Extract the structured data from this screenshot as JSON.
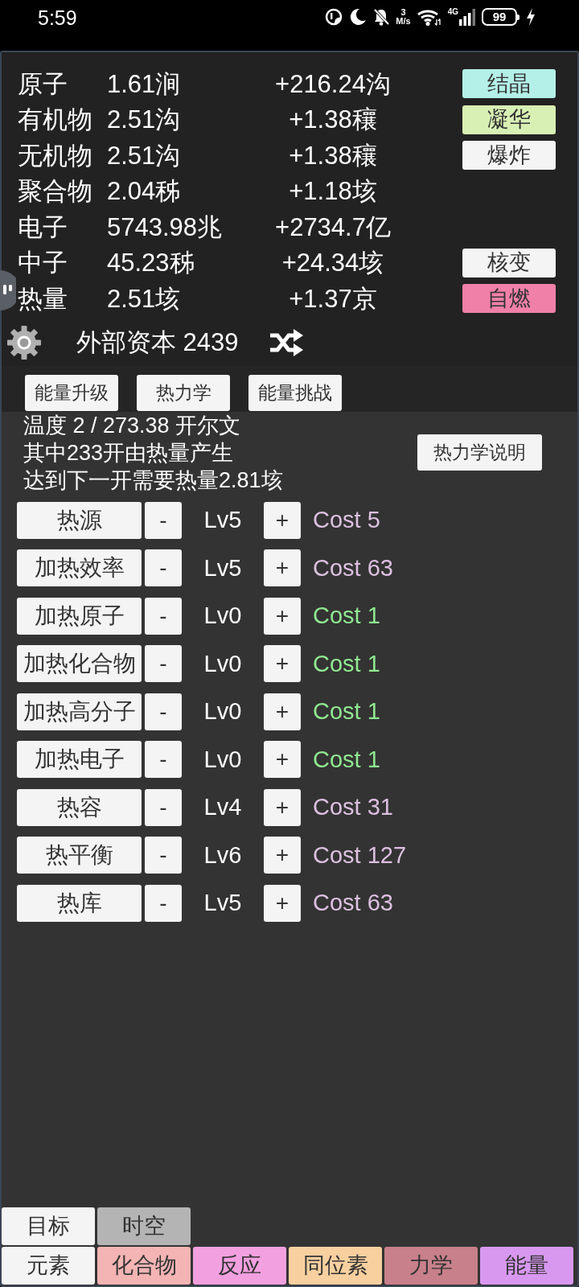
{
  "status_bar": {
    "time": "5:59",
    "net_speed": "3",
    "net_speed_unit": "M/s",
    "network": "4G",
    "battery": "99"
  },
  "resources": [
    {
      "name": "原子",
      "amount": "1.61涧",
      "rate": "+216.24沟",
      "action": {
        "label": "结晶",
        "color": "#b4f0e8"
      }
    },
    {
      "name": "有机物",
      "amount": "2.51沟",
      "rate": "+1.38穰",
      "action": {
        "label": "凝华",
        "color": "#d8f0b4"
      }
    },
    {
      "name": "无机物",
      "amount": "2.51沟",
      "rate": "+1.38穰",
      "action": {
        "label": "爆炸",
        "color": "#f4f4f4"
      }
    },
    {
      "name": "聚合物",
      "amount": "2.04秭",
      "rate": "+1.18垓"
    },
    {
      "name": "电子",
      "amount": "5743.98兆",
      "rate": "+2734.7亿"
    },
    {
      "name": "中子",
      "amount": "45.23秭",
      "rate": "+24.34垓",
      "action": {
        "label": "核变",
        "color": "#f4f4f4"
      }
    },
    {
      "name": "热量",
      "amount": "2.51垓",
      "rate": "+1.37京",
      "action": {
        "label": "自燃",
        "color": "#f080a8"
      }
    }
  ],
  "capital": "外部资本 2439",
  "sub_tabs": [
    {
      "label": "能量升级"
    },
    {
      "label": "热力学"
    },
    {
      "label": "能量挑战"
    }
  ],
  "thermo": {
    "lines": [
      "温度 2 / 273.38 开尔文",
      "其中233开由热量产生",
      "达到下一开需要热量2.81垓"
    ],
    "help_button": "热力学说明"
  },
  "upgrades": [
    {
      "name": "热源",
      "minus": "-",
      "level_label": "Lv5",
      "plus": "+",
      "cost": "Cost 5",
      "affordable": false
    },
    {
      "name": "加热效率",
      "minus": "-",
      "level_label": "Lv5",
      "plus": "+",
      "cost": "Cost 63",
      "affordable": false
    },
    {
      "name": "加热原子",
      "minus": "-",
      "level_label": "Lv0",
      "plus": "+",
      "cost": "Cost 1",
      "affordable": true
    },
    {
      "name": "加热化合物",
      "minus": "-",
      "level_label": "Lv0",
      "plus": "+",
      "cost": "Cost 1",
      "affordable": true
    },
    {
      "name": "加热高分子",
      "minus": "-",
      "level_label": "Lv0",
      "plus": "+",
      "cost": "Cost 1",
      "affordable": true
    },
    {
      "name": "加热电子",
      "minus": "-",
      "level_label": "Lv0",
      "plus": "+",
      "cost": "Cost 1",
      "affordable": true
    },
    {
      "name": "热容",
      "minus": "-",
      "level_label": "Lv4",
      "plus": "+",
      "cost": "Cost 31",
      "affordable": false
    },
    {
      "name": "热平衡",
      "minus": "-",
      "level_label": "Lv6",
      "plus": "+",
      "cost": "Cost 127",
      "affordable": false
    },
    {
      "name": "热库",
      "minus": "-",
      "level_label": "Lv5",
      "plus": "+",
      "cost": "Cost 63",
      "affordable": false
    }
  ],
  "bottom_tabs": [
    [
      {
        "label": "目标",
        "color": "#f4f4f4"
      },
      {
        "label": "时空",
        "color": "#b4b4b4"
      }
    ],
    [
      {
        "label": "元素",
        "color": "#f4f4f4"
      },
      {
        "label": "化合物",
        "color": "#f4b4b4"
      },
      {
        "label": "反应",
        "color": "#f2a0e0"
      },
      {
        "label": "同位素",
        "color": "#f8d0a0"
      },
      {
        "label": "力学",
        "color": "#c8808a"
      },
      {
        "label": "能量",
        "color": "#d898f0"
      }
    ]
  ]
}
